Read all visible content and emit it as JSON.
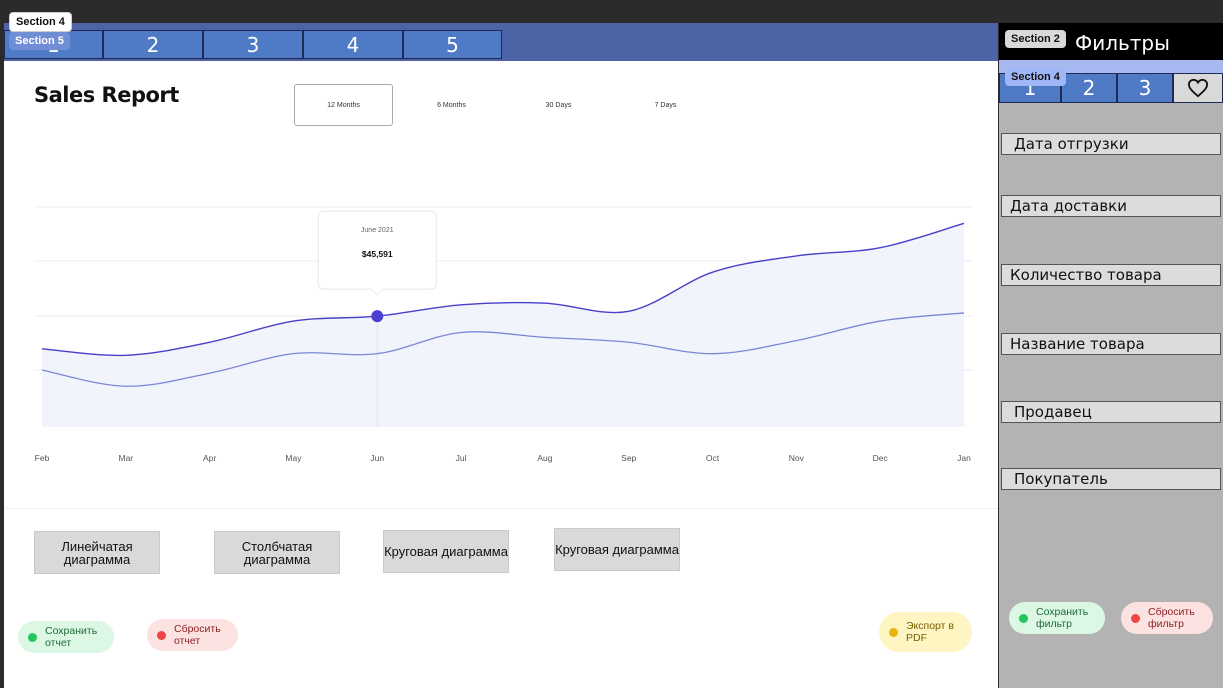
{
  "top_tabs": [
    "1",
    "2",
    "3",
    "4",
    "5"
  ],
  "section_labels": {
    "top_a": "Section 4",
    "top_b": "Section 5",
    "filters": "Section 2",
    "filter_tabs": "Section 4"
  },
  "report": {
    "title": "Sales Report",
    "periods": [
      "12 Months",
      "6 Months",
      "30 Days",
      "7 Days"
    ],
    "active_period": "12 Months",
    "tooltip": {
      "date": "June 2021",
      "value": "$45,591"
    }
  },
  "chart_data": {
    "type": "area",
    "x": [
      "Feb",
      "Mar",
      "Apr",
      "May",
      "Jun",
      "Jul",
      "Aug",
      "Sep",
      "Oct",
      "Nov",
      "Dec",
      "Jan"
    ],
    "series": [
      {
        "values": [
          0.53,
          0.49,
          0.57,
          0.7,
          0.73,
          0.8,
          0.81,
          0.76,
          1.0,
          1.1,
          1.15,
          1.3
        ],
        "color": "#4a3fc9"
      },
      {
        "values": [
          0.4,
          0.3,
          0.38,
          0.5,
          0.5,
          0.63,
          0.6,
          0.57,
          0.5,
          0.58,
          0.7,
          0.75
        ],
        "color": "#7b86d6"
      }
    ],
    "highlight": {
      "x": "Jun",
      "label": "June 2021",
      "value": "$45,591"
    },
    "grid": true,
    "colors": {
      "fill": "#f1f4fb",
      "grid": "#eceef3",
      "marker": "#4b3fd0"
    }
  },
  "chart_types": [
    "Линейчатая диаграмма",
    "Столбчатая диаграмма",
    "Круговая диаграмма",
    "Круговая диаграмма"
  ],
  "actions": {
    "save_report": "Сохранить отчет",
    "reset_report": "Сбросить отчет",
    "export_pdf": "Экспорт в PDF",
    "save_filter": "Сохранить фильтр",
    "reset_filter": "Сбросить фильтр"
  },
  "filters": {
    "title": "Фильтры",
    "tabs": [
      "1",
      "2",
      "3"
    ],
    "favorite_icon": "heart-icon",
    "fields": [
      "Дата отгрузки",
      "Дата доставки",
      "Количество товара",
      "Название товара",
      "Продавец",
      "Покупатель"
    ]
  },
  "colors": {
    "tab_bar": "#4e63a6",
    "tab": "#4f7bc6",
    "filter_bg": "#b3b3b3",
    "save": "#22c55e",
    "reset": "#ef4444",
    "export": "#eab308"
  }
}
